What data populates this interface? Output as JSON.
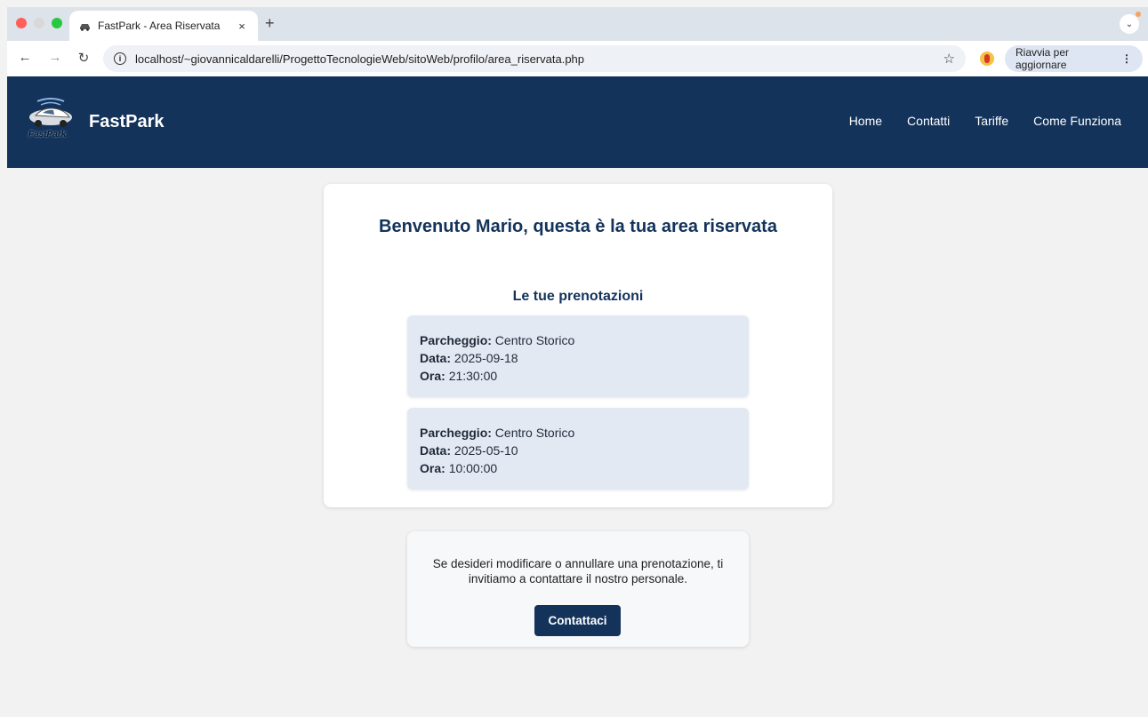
{
  "browser": {
    "tab_title": "FastPark - Area Riservata",
    "tab_close": "×",
    "new_tab": "+",
    "url": "localhost/~giovannicaldarelli/ProgettoTecnologieWeb/sitoWeb/profilo/area_riservata.php",
    "update_label": "Riavvia per aggiornare",
    "update_menu": "⋮",
    "back": "←",
    "forward": "→",
    "reload": "↻",
    "star": "☆",
    "tab_menu": "⌄"
  },
  "header": {
    "brand": "FastPark",
    "logo_text": "FastPark",
    "nav": [
      {
        "label": "Home"
      },
      {
        "label": "Contatti"
      },
      {
        "label": "Tariffe"
      },
      {
        "label": "Come Funziona"
      }
    ]
  },
  "main": {
    "welcome": "Benvenuto Mario, questa è la tua area riservata",
    "bookings_title": "Le tue prenotazioni",
    "labels": {
      "parking": "Parcheggio:",
      "date": "Data:",
      "time": "Ora:"
    },
    "bookings": [
      {
        "parking": "Centro Storico",
        "date": "2025-09-18",
        "time": "21:30:00"
      },
      {
        "parking": "Centro Storico",
        "date": "2025-05-10",
        "time": "10:00:00"
      }
    ]
  },
  "contact": {
    "message": "Se desideri modificare o annullare una prenotazione, ti invitiamo a contattare il nostro personale.",
    "button": "Contattaci"
  },
  "colors": {
    "header_bg": "#13335b",
    "page_bg": "#f2f2f2",
    "booking_bg": "#e3e9f2"
  }
}
